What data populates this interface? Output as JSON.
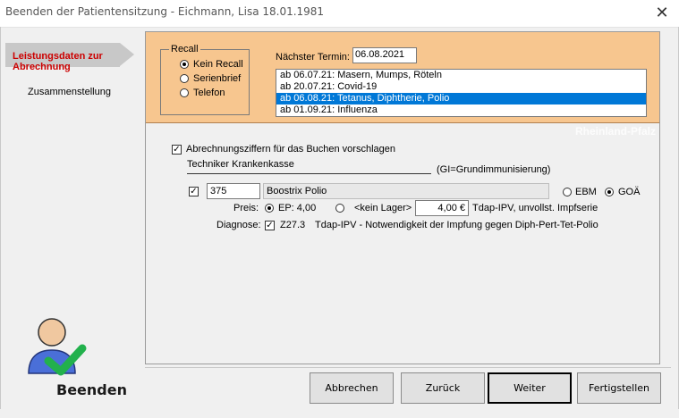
{
  "window": {
    "title": "Beenden der Patientensitzung - Eichmann, Lisa  18.01.1981",
    "close_glyph": "✕"
  },
  "nav": {
    "active_item": "Leistungsdaten zur Abrechnung",
    "items": [
      {
        "label": "Zusammenstellung"
      }
    ]
  },
  "exit": {
    "label": "Beenden",
    "icon": "user-check-icon",
    "colors": {
      "person": "#4a6fd8",
      "head": "#f0c8a0",
      "check": "#22b14c"
    }
  },
  "recall": {
    "legend": "Recall",
    "options": [
      {
        "label": "Kein Recall",
        "checked": true
      },
      {
        "label": "Serienbrief",
        "checked": false
      },
      {
        "label": "Telefon",
        "checked": false
      }
    ]
  },
  "next_appointment": {
    "label": "Nächster Termin:",
    "value": "06.08.2021"
  },
  "termin_list": [
    {
      "text": "ab 06.07.21: Masern, Mumps, Röteln",
      "selected": false
    },
    {
      "text": "ab 20.07.21: Covid-19",
      "selected": false
    },
    {
      "text": "ab 06.08.21: Tetanus, Diphtherie, Polio",
      "selected": true
    },
    {
      "text": "ab 01.09.21: Influenza",
      "selected": false
    }
  ],
  "region": "Rheinland-Pfalz",
  "billing": {
    "suggest_checkbox": {
      "label": "Abrechnungsziffern für das Buchen vorschlagen",
      "checked": true
    },
    "insurance": "Techniker Krankenkasse",
    "gi_note": "(GI=Grundimmunisierung)",
    "item": {
      "checked": true,
      "code": "375",
      "name": "Boostrix Polio"
    },
    "fee_schedule": [
      {
        "label": "EBM",
        "checked": false
      },
      {
        "label": "GOÄ",
        "checked": true
      }
    ],
    "price": {
      "label": "Preis:",
      "ep_label": "EP: 4,00",
      "ep_checked": true,
      "stock_label": "<kein Lager>",
      "stock_checked": false,
      "amount": "4,00 €",
      "description": "Tdap-IPV, unvollst. Impfserie"
    },
    "diagnosis": {
      "label": "Diagnose:",
      "checked": true,
      "code": "Z27.3",
      "text": "Tdap-IPV - Notwendigkeit der Impfung gegen Diph-Pert-Tet-Polio"
    }
  },
  "buttons": {
    "cancel": "Abbrechen",
    "back": "Zurück",
    "next": "Weiter",
    "finish": "Fertigstellen"
  }
}
